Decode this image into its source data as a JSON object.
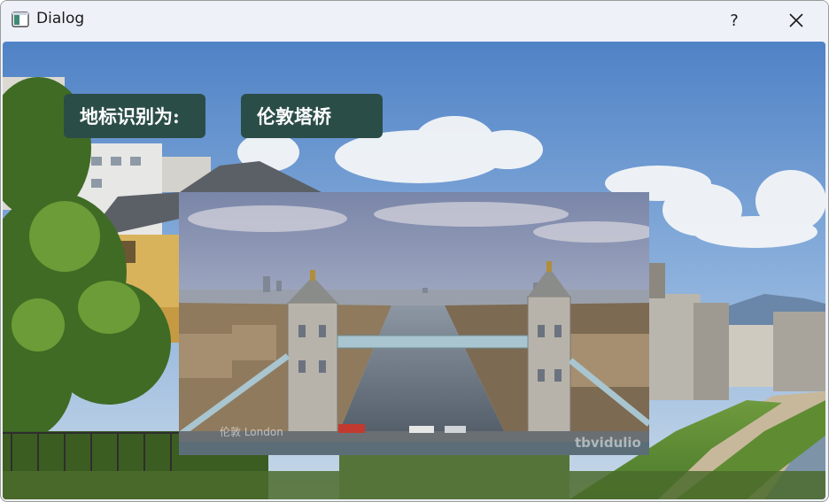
{
  "window": {
    "title": "Dialog",
    "help_glyph": "?",
    "close_glyph": "✕"
  },
  "recognition": {
    "prefix_label": "地标识别为:",
    "result_label": "伦敦塔桥"
  },
  "images": {
    "background": "kyoto-street-scene-photo",
    "landmark": "tower-bridge-photo",
    "landmark_caption_watermark": "伦敦 London",
    "landmark_brand_watermark": "tbvidulio"
  },
  "colors": {
    "label_bg": "#2b4d47",
    "label_text": "#ffffff",
    "titlebar_bg": "#eef1f8"
  }
}
